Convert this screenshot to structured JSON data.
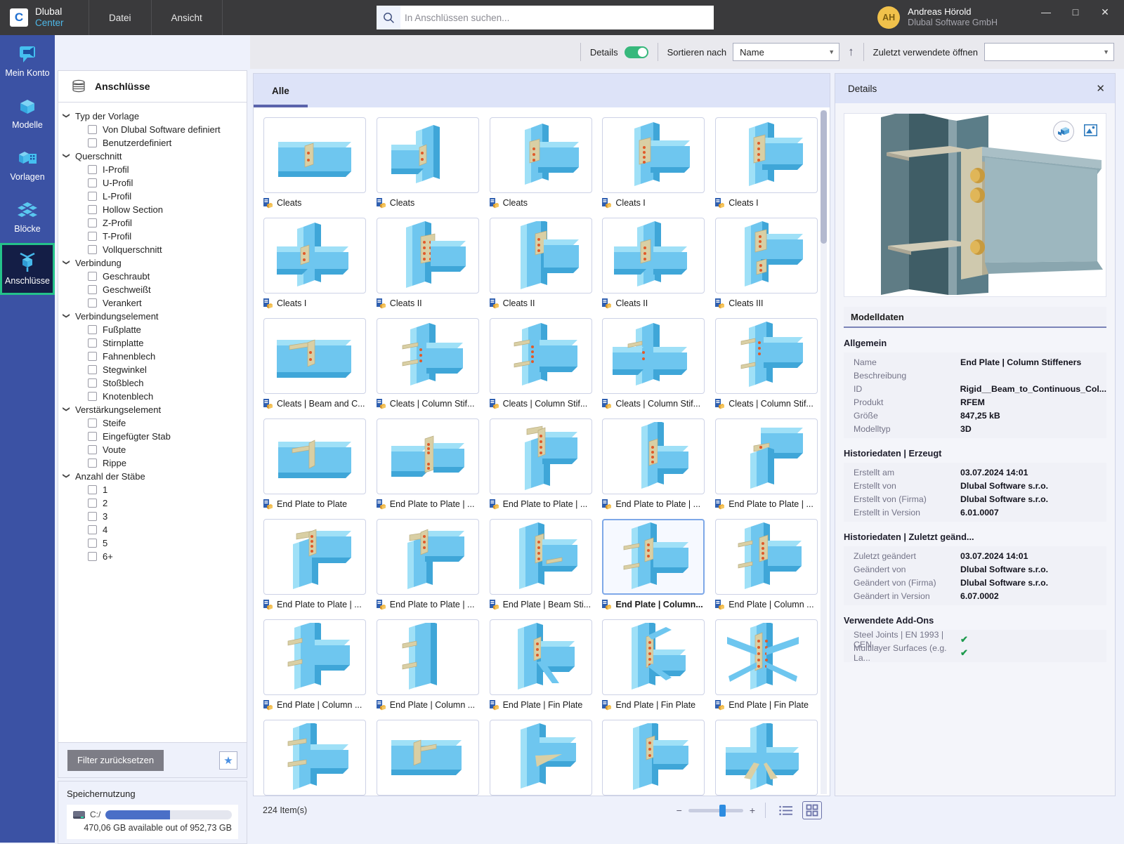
{
  "titlebar": {
    "brand_line1": "Dlubal",
    "brand_line2": "Center",
    "logo_glyph": "C",
    "menus": [
      "Datei",
      "Ansicht"
    ],
    "search_placeholder": "In Anschlüssen suchen...",
    "search_value": "",
    "user_initials": "AH",
    "user_name": "Andreas Hörold",
    "user_org": "Dlubal Software GmbH",
    "window_minimize": "—",
    "window_maximize": "□",
    "window_close": "✕"
  },
  "rail": {
    "items": [
      {
        "label": "Mein Konto",
        "icon": "account-icon",
        "active": false
      },
      {
        "label": "Modelle",
        "icon": "cube-icon",
        "active": false
      },
      {
        "label": "Vorlagen",
        "icon": "templates-icon",
        "active": false
      },
      {
        "label": "Blöcke",
        "icon": "blocks-icon",
        "active": false
      },
      {
        "label": "Anschlüsse",
        "icon": "connections-icon",
        "active": true
      }
    ]
  },
  "topbar": {
    "page_title": "Anschlüsse",
    "details_label": "Details",
    "details_enabled": true,
    "sort_label": "Sortieren nach",
    "sort_value": "Name",
    "sort_direction": "↑",
    "recent_label": "Zuletzt verwendete öffnen",
    "recent_value": ""
  },
  "filter_panel": {
    "header": "Anschlüsse",
    "groups": [
      {
        "label": "Typ der Vorlage",
        "options": [
          "Von Dlubal Software definiert",
          "Benutzerdefiniert"
        ]
      },
      {
        "label": "Querschnitt",
        "options": [
          "I-Profil",
          "U-Profil",
          "L-Profil",
          "Hollow Section",
          "Z-Profil",
          "T-Profil",
          "Vollquerschnitt"
        ]
      },
      {
        "label": "Verbindung",
        "options": [
          "Geschraubt",
          "Geschweißt",
          "Verankert"
        ]
      },
      {
        "label": "Verbindungselement",
        "options": [
          "Fußplatte",
          "Stirnplatte",
          "Fahnenblech",
          "Stegwinkel",
          "Stoßblech",
          "Knotenblech"
        ]
      },
      {
        "label": "Verstärkungselement",
        "options": [
          "Steife",
          "Eingefügter Stab",
          "Voute",
          "Rippe"
        ]
      },
      {
        "label": "Anzahl der Stäbe",
        "options": [
          "1",
          "2",
          "3",
          "4",
          "5",
          "6+"
        ]
      }
    ],
    "reset_button": "Filter zurücksetzen",
    "favorites_icon": "star-icon",
    "storage_title": "Speichernutzung",
    "storage_drive": "C:/",
    "storage_note": "470,06 GB available out of 952,73 GB",
    "storage_used_percent": 51
  },
  "main": {
    "tabs": [
      {
        "label": "Alle",
        "active": true
      }
    ],
    "item_count_label": "224 Item(s)",
    "zoom_minus": "−",
    "zoom_plus": "+",
    "list_view_icon": "list-view-icon",
    "grid_view_icon": "grid-view-icon",
    "items": [
      {
        "label": "Cleats",
        "kind": "cleat-a"
      },
      {
        "label": "Cleats",
        "kind": "cleat-b"
      },
      {
        "label": "Cleats",
        "kind": "cleat-c"
      },
      {
        "label": "Cleats I",
        "kind": "cleat-d"
      },
      {
        "label": "Cleats I",
        "kind": "cleat-e"
      },
      {
        "label": "Cleats I",
        "kind": "cleat-f"
      },
      {
        "label": "Cleats II",
        "kind": "cleat-g"
      },
      {
        "label": "Cleats II",
        "kind": "cleat-h"
      },
      {
        "label": "Cleats II",
        "kind": "cleat-i"
      },
      {
        "label": "Cleats III",
        "kind": "cleat-j"
      },
      {
        "label": "Cleats | Beam and C...",
        "kind": "cleat-k"
      },
      {
        "label": "Cleats | Column Stif...",
        "kind": "cleat-l"
      },
      {
        "label": "Cleats | Column Stif...",
        "kind": "cleat-m"
      },
      {
        "label": "Cleats | Column Stif...",
        "kind": "cleat-n"
      },
      {
        "label": "Cleats | Column Stif...",
        "kind": "cleat-o"
      },
      {
        "label": "End Plate to Plate",
        "kind": "ep-a"
      },
      {
        "label": "End Plate to Plate | ...",
        "kind": "ep-b"
      },
      {
        "label": "End Plate to Plate | ...",
        "kind": "ep-c"
      },
      {
        "label": "End Plate to Plate | ...",
        "kind": "ep-d"
      },
      {
        "label": "End Plate to Plate | ...",
        "kind": "ep-e"
      },
      {
        "label": "End Plate to Plate | ...",
        "kind": "ep-f"
      },
      {
        "label": "End Plate to Plate | ...",
        "kind": "ep-g"
      },
      {
        "label": "End Plate | Beam Sti...",
        "kind": "ep-h"
      },
      {
        "label": "End Plate | Column...",
        "kind": "ep-i",
        "selected": true
      },
      {
        "label": "End Plate | Column ...",
        "kind": "ep-j"
      },
      {
        "label": "End Plate | Column ...",
        "kind": "ep-k"
      },
      {
        "label": "End Plate | Column ...",
        "kind": "ep-l"
      },
      {
        "label": "End Plate | Fin Plate",
        "kind": "fp-a"
      },
      {
        "label": "End Plate | Fin Plate",
        "kind": "fp-b"
      },
      {
        "label": "End Plate | Fin Plate",
        "kind": "fp-c"
      },
      {
        "label": "",
        "kind": "row7-a"
      },
      {
        "label": "",
        "kind": "row7-b"
      },
      {
        "label": "",
        "kind": "row7-c"
      },
      {
        "label": "",
        "kind": "row7-d"
      },
      {
        "label": "",
        "kind": "row7-e"
      }
    ]
  },
  "details": {
    "header": "Details",
    "close_icon": "close-icon",
    "preview_3d_icon": "rotate-3d-icon",
    "preview_image_icon": "image-icon",
    "modeldata_header": "Modelldaten",
    "sections": [
      {
        "title": "Allgemein",
        "rows": [
          {
            "key": "Name",
            "value": "End Plate | Column Stiffeners"
          },
          {
            "key": "Beschreibung",
            "value": ""
          },
          {
            "key": "ID",
            "value": "Rigid__Beam_to_Continuous_Col..."
          },
          {
            "key": "Produkt",
            "value": "RFEM"
          },
          {
            "key": "Größe",
            "value": "847,25 kB"
          },
          {
            "key": "Modelltyp",
            "value": "3D"
          }
        ]
      },
      {
        "title": "Historiedaten | Erzeugt",
        "rows": [
          {
            "key": "Erstellt am",
            "value": "03.07.2024 14:01"
          },
          {
            "key": "Erstellt von",
            "value": "Dlubal Software s.r.o."
          },
          {
            "key": "Erstellt von (Firma)",
            "value": "Dlubal Software s.r.o."
          },
          {
            "key": "Erstellt in Version",
            "value": "6.01.0007"
          }
        ]
      },
      {
        "title": "Historiedaten | Zuletzt geänd...",
        "rows": [
          {
            "key": "Zuletzt geändert",
            "value": "03.07.2024 14:01"
          },
          {
            "key": "Geändert von",
            "value": "Dlubal Software s.r.o."
          },
          {
            "key": "Geändert von (Firma)",
            "value": "Dlubal Software s.r.o."
          },
          {
            "key": "Geändert in Version",
            "value": "6.07.0002"
          }
        ]
      },
      {
        "title": "Verwendete Add-Ons",
        "rows": [
          {
            "key": "Steel Joints | EN 1993 | CEN...",
            "value": "✔",
            "check": true
          },
          {
            "key": "Multilayer Surfaces (e.g. La...",
            "value": "✔",
            "check": true
          }
        ]
      }
    ]
  },
  "colors": {
    "accent": "#3b52a4",
    "active_rail": "#24c28a",
    "toggle_on": "#37b87c",
    "tab_underline": "#5a63ab",
    "steel_blue": "#6ec6ef",
    "plate_tan": "#d9cfa4"
  }
}
